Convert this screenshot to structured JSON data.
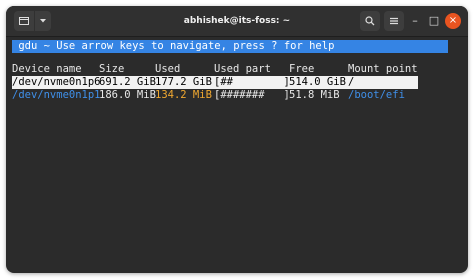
{
  "window": {
    "title": "abhishek@its-foss: ~",
    "buttons": {
      "new_tab_icon": "terminal-tab-icon",
      "dropdown_icon": "chevron-down-icon",
      "search_icon": "search-icon",
      "menu_icon": "hamburger-menu-icon",
      "minimize": "–",
      "maximize": "□",
      "close": "×"
    }
  },
  "terminal": {
    "header": " gdu ~ Use arrow keys to navigate, press ? for help",
    "columns": [
      "Device name",
      "Size",
      "Used",
      "Used part",
      "Free",
      "Mount point"
    ],
    "rows": [
      {
        "device": "/dev/nvme0n1p6",
        "size": "691.2 GiB",
        "used": "177.2 GiB",
        "used_part": "[##        ]",
        "free": "514.0 GiB",
        "mount": "/",
        "selected": true
      },
      {
        "device": "/dev/nvme0n1p1",
        "size": "186.0 MiB",
        "used": "134.2 MiB",
        "used_part": "[#######   ]",
        "free": "51.8 MiB",
        "mount": "/boot/efi",
        "selected": false
      }
    ]
  },
  "colors": {
    "header_bar": "#3584e4",
    "selected_row_bg": "#f2f2f2",
    "device_link": "#3f8fe8",
    "warning_used": "#f0a830",
    "close_button": "#e95420",
    "terminal_bg": "#2b2b2b"
  }
}
